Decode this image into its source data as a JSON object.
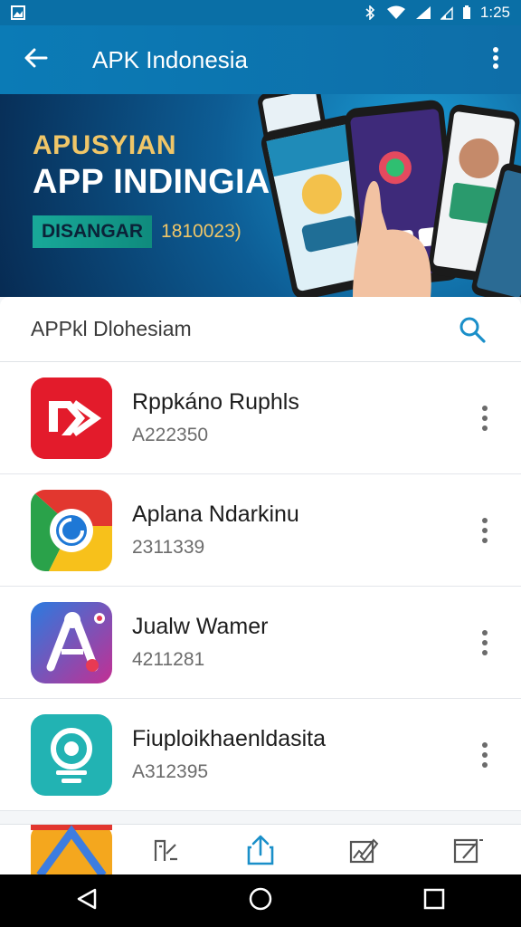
{
  "status_bar": {
    "time": "1:25"
  },
  "app_bar": {
    "title": "APK Indonesia"
  },
  "banner": {
    "line1": "APUSYIAN",
    "line2": "APP INDINGIA",
    "tag": "DISANGAR",
    "code": "1810023)"
  },
  "search": {
    "label": "APPkl Dlohesiam"
  },
  "apps": [
    {
      "name": "Rppkáno Ruphls",
      "sub": "A222350",
      "icon": "red-play-icon"
    },
    {
      "name": "Aplana Ndarkinu",
      "sub": "2311339",
      "icon": "chrome-like-icon"
    },
    {
      "name": "Jualw Wamer",
      "sub": "4211281",
      "icon": "tools-app-icon"
    },
    {
      "name": "Fiuploikhaenldasita",
      "sub": "A312395",
      "icon": "camera-app-icon"
    }
  ],
  "toolbar": {
    "items": [
      "bookmark-icon",
      "share-icon",
      "image-edit-icon",
      "edit-window-icon"
    ]
  },
  "colors": {
    "accent": "#0b7bb6",
    "search_icon": "#1a8fc9",
    "active_tool": "#1a8fc9"
  }
}
